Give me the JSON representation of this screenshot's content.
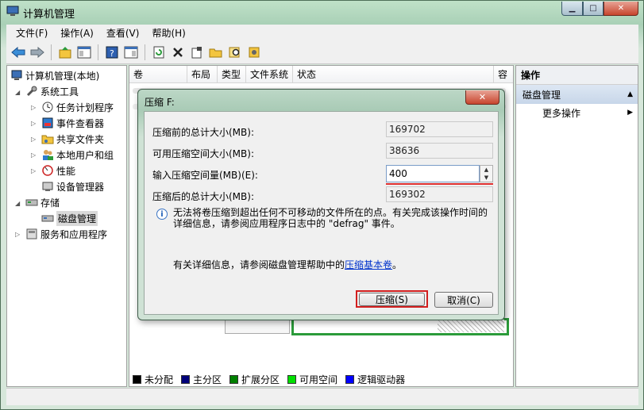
{
  "window": {
    "title": "计算机管理",
    "controls": {
      "minimize": "▁",
      "maximize": "□",
      "close": "✕"
    }
  },
  "menu": [
    "文件(F)",
    "操作(A)",
    "查看(V)",
    "帮助(H)"
  ],
  "tree": {
    "root": "计算机管理(本地)",
    "system_tools": "系统工具",
    "task_scheduler": "任务计划程序",
    "event_viewer": "事件查看器",
    "shared_folders": "共享文件夹",
    "local_users": "本地用户和组",
    "performance": "性能",
    "device_manager": "设备管理器",
    "storage": "存储",
    "disk_management": "磁盘管理",
    "services_apps": "服务和应用程序"
  },
  "columns": [
    "卷",
    "布局",
    "类型",
    "文件系统",
    "状态",
    "容"
  ],
  "legend": [
    {
      "label": "未分配",
      "color": "#000000"
    },
    {
      "label": "主分区",
      "color": "#00007a"
    },
    {
      "label": "扩展分区",
      "color": "#008000"
    },
    {
      "label": "可用空间",
      "color": "#00e000"
    },
    {
      "label": "逻辑驱动器",
      "color": "#0000ff"
    }
  ],
  "actions": {
    "header": "操作",
    "group": "磁盘管理",
    "more": "更多操作"
  },
  "dialog": {
    "title": "压缩 F:",
    "close": "✕",
    "total_before_label": "压缩前的总计大小(MB):",
    "total_before_value": "169702",
    "available_label": "可用压缩空间大小(MB):",
    "available_value": "38636",
    "input_label": "输入压缩空间量(MB)(E):",
    "input_value": "400",
    "total_after_label": "压缩后的总计大小(MB):",
    "total_after_value": "169302",
    "info_line1": "无法将卷压缩到超出任何不可移动的文件所在的点。有关完成该操作时间的",
    "info_line2": "详细信息，请参阅应用程序日志中的 \"defrag\" 事件。",
    "help_prefix": "有关详细信息，请参阅磁盘管理帮助中的",
    "help_link": "压缩基本卷",
    "help_suffix": "。",
    "shrink_button": "压缩(S)",
    "cancel_button": "取消(C)"
  }
}
